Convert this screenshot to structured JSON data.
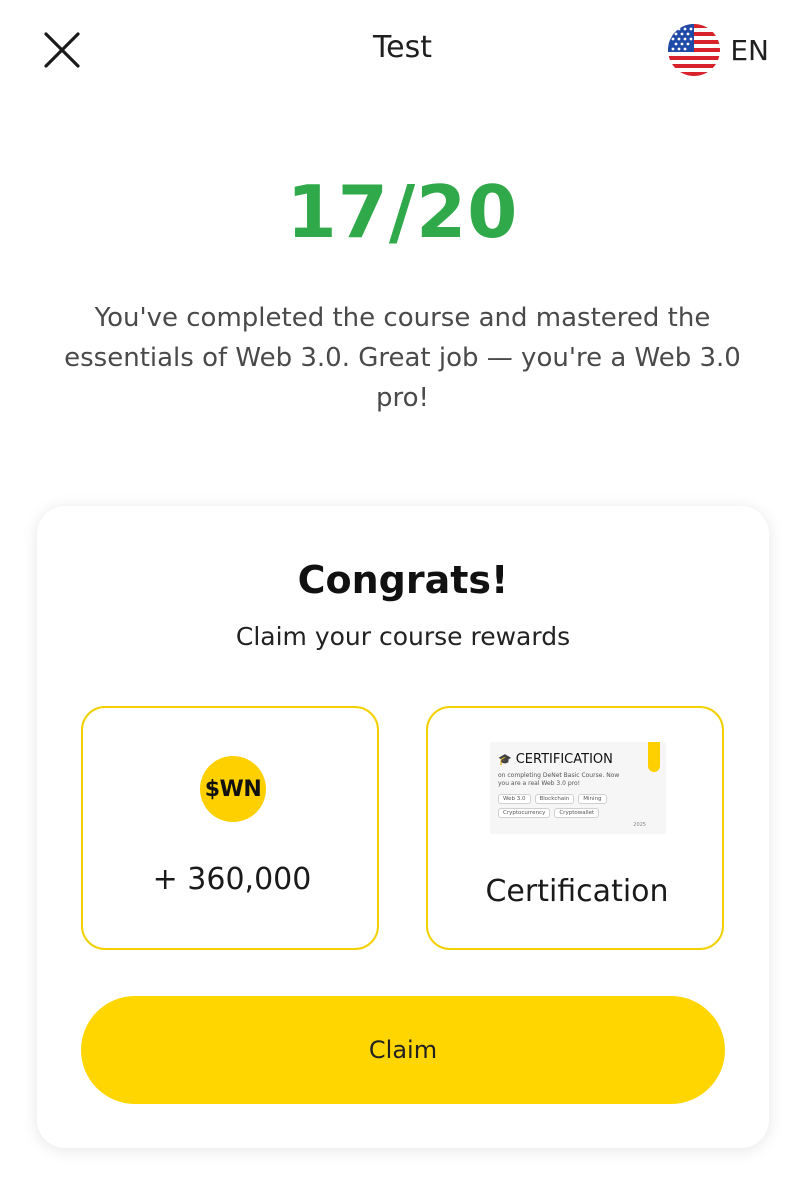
{
  "header": {
    "title": "Test",
    "language": "EN"
  },
  "result": {
    "score": "17/20",
    "message": "You've completed the course and mastered the essentials of Web 3.0. Great job — you're a Web 3.0 pro!"
  },
  "rewards_card": {
    "title": "Congrats!",
    "subtitle": "Claim your course rewards",
    "coin_reward": {
      "token_label": "$WN",
      "amount": "+ 360,000"
    },
    "certificate_reward": {
      "label": "Certification",
      "preview": {
        "heading": "CERTIFICATION",
        "text": "on completing DeNet Basic Course. Now you are a real Web 3.0 pro!",
        "tags": [
          "Web 3.0",
          "Blockchain",
          "Mining",
          "Cryptocurrency",
          "Cryptowallet"
        ],
        "year": "2025"
      }
    },
    "claim_label": "Claim"
  },
  "colors": {
    "score_green": "#2fa94a",
    "accent_yellow": "#ffd600",
    "reward_border": "#f3d000"
  },
  "icons": {
    "close": "close-icon",
    "flag": "us-flag-icon",
    "coin": "coin-icon",
    "graduation": "graduation-cap-icon"
  }
}
